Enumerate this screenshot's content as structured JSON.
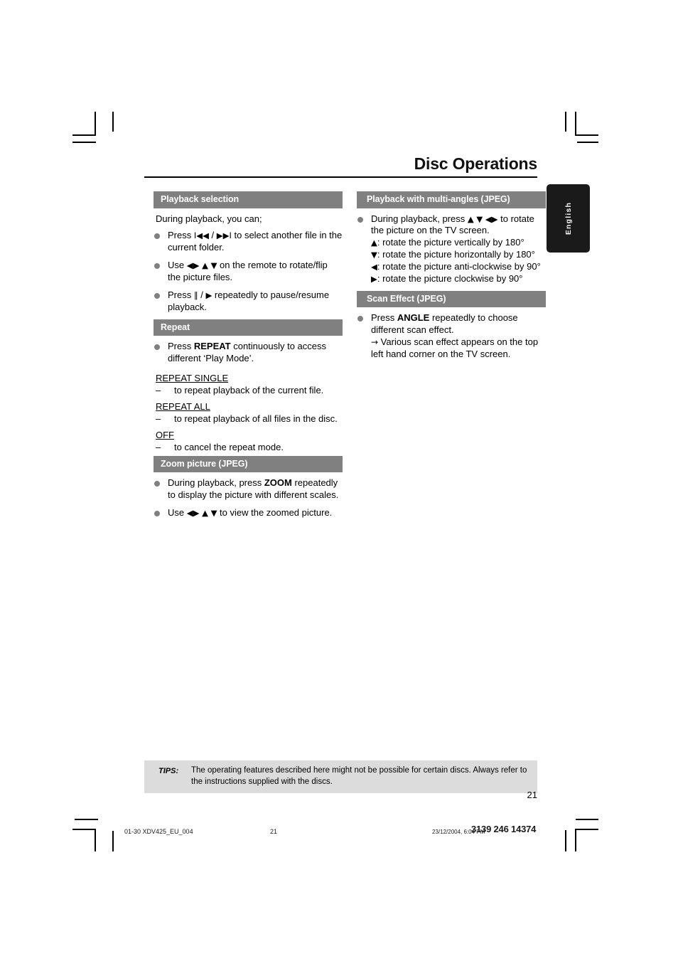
{
  "page": {
    "title": "Disc Operations",
    "language_tab": "English",
    "page_number": "21"
  },
  "left_column": [
    {
      "id": "playback-selection",
      "heading": "Playback selection",
      "intro": "During playback, you can;",
      "bullets": [
        {
          "parts": [
            {
              "t": "text",
              "v": "Press "
            },
            {
              "t": "glyph",
              "v": "I◀◀"
            },
            {
              "t": "text",
              "v": " / "
            },
            {
              "t": "glyph",
              "v": "▶▶I"
            },
            {
              "t": "text",
              "v": " to select another file in the current folder."
            }
          ]
        },
        {
          "parts": [
            {
              "t": "text",
              "v": "Use "
            },
            {
              "t": "glyph",
              "v": "◀▶ ▲ ▼"
            },
            {
              "t": "text",
              "v": " on the remote to rotate/flip the picture files."
            }
          ]
        },
        {
          "parts": [
            {
              "t": "text",
              "v": "Press "
            },
            {
              "t": "glyph",
              "v": "‖"
            },
            {
              "t": "text",
              "v": " / "
            },
            {
              "t": "glyph",
              "v": "▶"
            },
            {
              "t": "text",
              "v": " repeatedly to pause/resume playback."
            }
          ]
        }
      ]
    },
    {
      "id": "repeat",
      "heading": "Repeat",
      "bullets": [
        {
          "parts": [
            {
              "t": "text",
              "v": "Press "
            },
            {
              "t": "bold",
              "v": "REPEAT"
            },
            {
              "t": "text",
              "v": " continuously to access different ‘Play Mode’."
            }
          ]
        }
      ],
      "modes": [
        {
          "name": "REPEAT SINGLE",
          "desc": "to repeat playback of the current file."
        },
        {
          "name": "REPEAT ALL",
          "desc": "to repeat playback of all files in the disc."
        },
        {
          "name": "OFF",
          "desc": "to cancel the repeat mode."
        }
      ]
    },
    {
      "id": "zoom-picture-jpeg",
      "heading": "Zoom picture (JPEG)",
      "bullets": [
        {
          "parts": [
            {
              "t": "text",
              "v": "During playback, press "
            },
            {
              "t": "bold",
              "v": "ZOOM"
            },
            {
              "t": "text",
              "v": " repeatedly to display the picture with different scales."
            }
          ]
        },
        {
          "parts": [
            {
              "t": "text",
              "v": "Use "
            },
            {
              "t": "glyph",
              "v": "◀▶ ▲ ▼"
            },
            {
              "t": "text",
              "v": " to view the zoomed picture."
            }
          ]
        }
      ]
    }
  ],
  "right_column": [
    {
      "id": "playback-multi-angles-jpeg",
      "heading": "Playback with multi-angles (JPEG)",
      "bullets": [
        {
          "parts": [
            {
              "t": "text",
              "v": "During playback, press "
            },
            {
              "t": "glyph",
              "v": "▲ ▼ ◀▶"
            },
            {
              "t": "text",
              "v": " to rotate the picture on the TV screen."
            }
          ],
          "sublines": [
            {
              "parts": [
                {
                  "t": "glyph",
                  "v": "▲"
                },
                {
                  "t": "text",
                  "v": ": rotate the picture vertically by 180°"
                }
              ]
            },
            {
              "parts": [
                {
                  "t": "glyph",
                  "v": "▼"
                },
                {
                  "t": "text",
                  "v": ": rotate the picture horizontally by 180°"
                }
              ]
            },
            {
              "parts": [
                {
                  "t": "glyph",
                  "v": "◀"
                },
                {
                  "t": "text",
                  "v": ": rotate the picture anti-clockwise by 90°"
                }
              ]
            },
            {
              "parts": [
                {
                  "t": "glyph",
                  "v": "▶"
                },
                {
                  "t": "text",
                  "v": ": rotate the picture clockwise by 90°"
                }
              ]
            }
          ]
        }
      ]
    },
    {
      "id": "scan-effect-jpeg",
      "heading": "Scan Effect (JPEG)",
      "bullets": [
        {
          "parts": [
            {
              "t": "text",
              "v": "Press "
            },
            {
              "t": "bold",
              "v": "ANGLE"
            },
            {
              "t": "text",
              "v": " repeatedly to choose different scan effect."
            }
          ],
          "sublines": [
            {
              "parts": [
                {
                  "t": "arrow",
                  "v": "→"
                },
                {
                  "t": "text",
                  "v": " Various scan effect appears on the top left hand corner on the TV screen."
                }
              ]
            }
          ]
        }
      ]
    }
  ],
  "tips": {
    "label": "TIPS:",
    "text": "The operating features described here might not be possible for certain discs.  Always refer to the instructions supplied with the discs."
  },
  "footer": {
    "file": "01-30 XDV425_EU_004",
    "page": "21",
    "date": "23/12/2004, 6:04 PM",
    "code": "3139 246 14374"
  },
  "colors": {
    "section_header_bg": "#808080",
    "section_header_text": "#ffffff",
    "bullet": "#808080",
    "tips_bg": "#dcdcdc",
    "lang_tab_bg": "#1a1a1a"
  }
}
